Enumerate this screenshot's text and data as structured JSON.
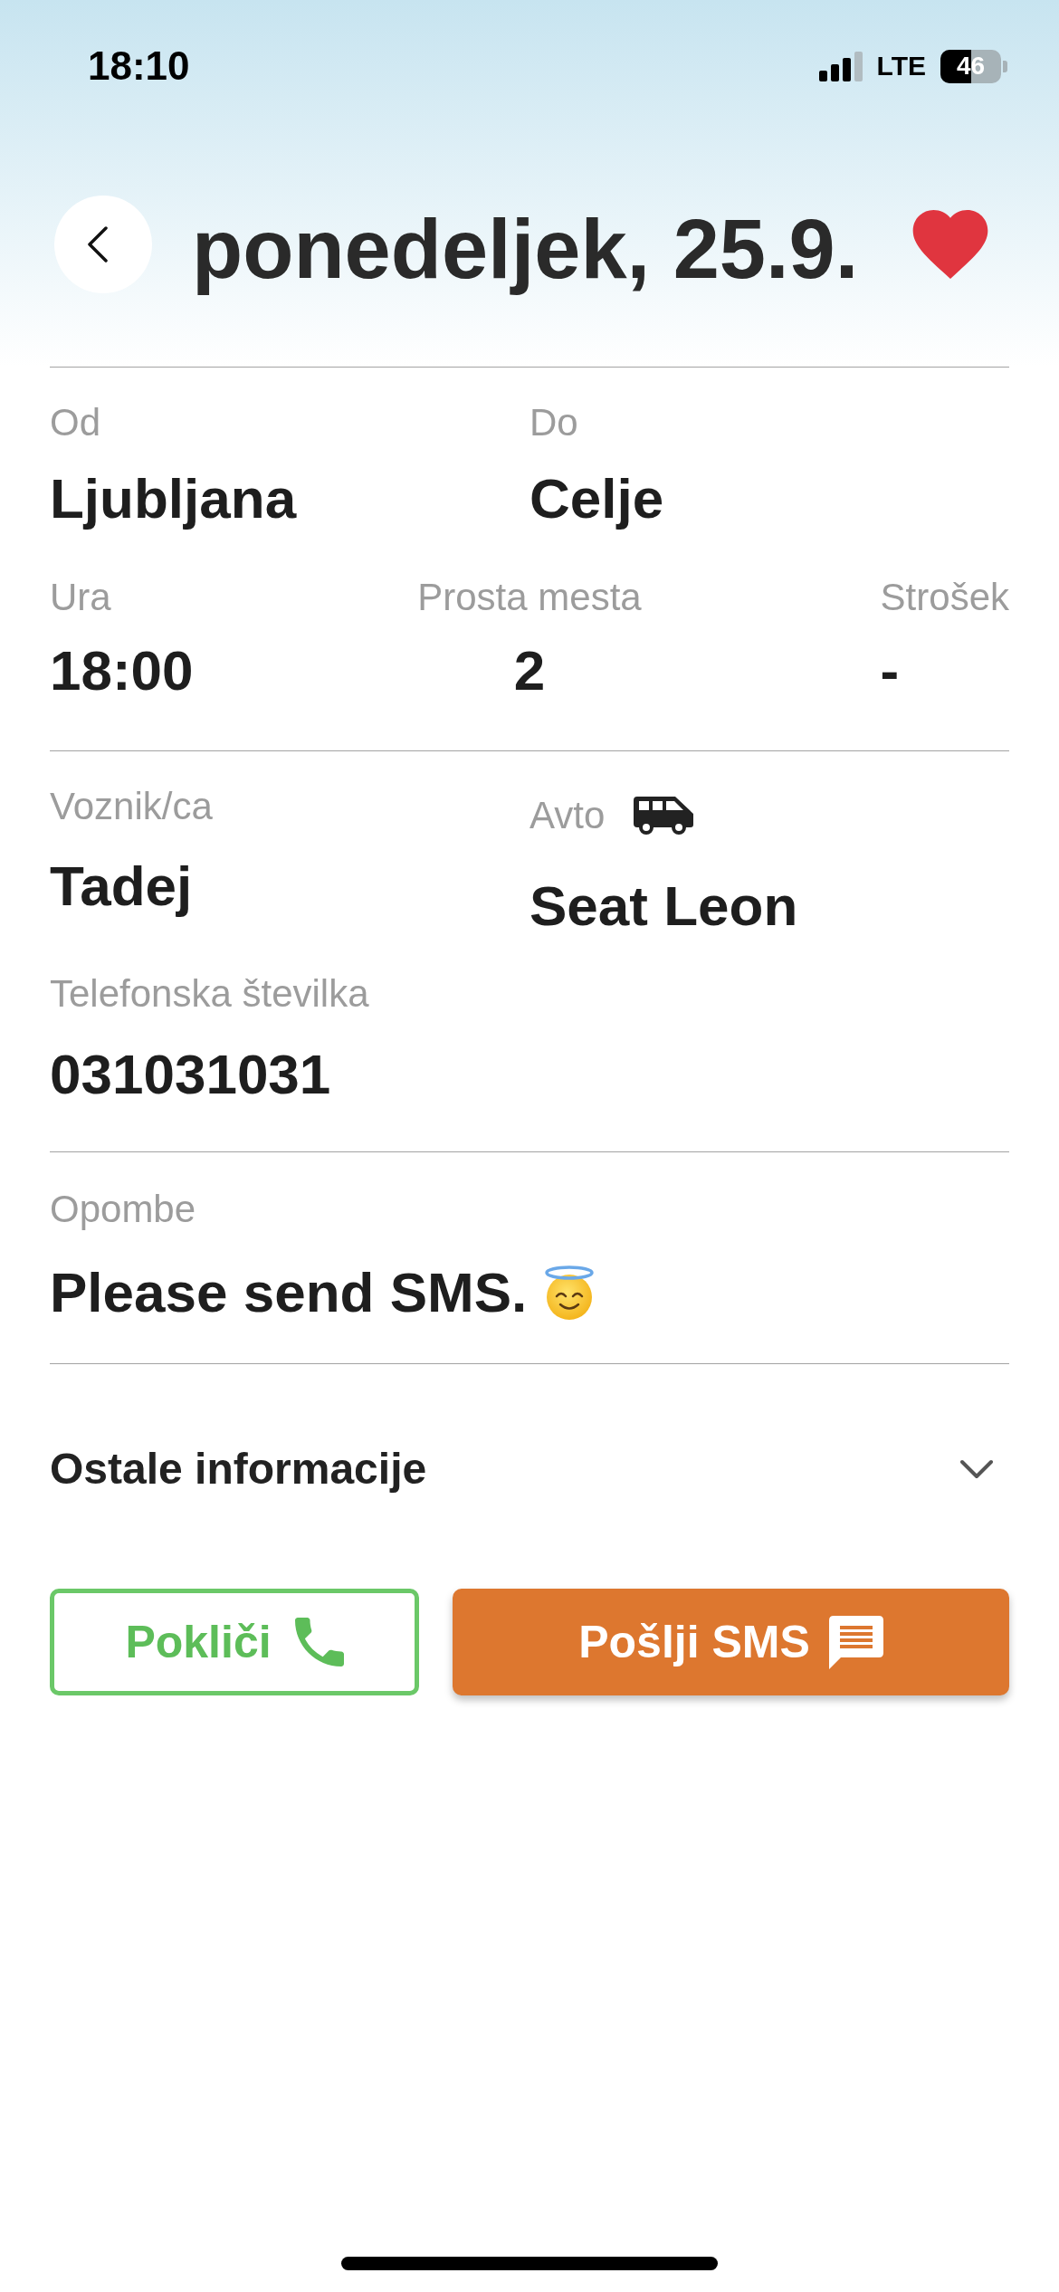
{
  "status_bar": {
    "time": "18:10",
    "network": "LTE",
    "battery": "46"
  },
  "header": {
    "title": "ponedeljek, 25.9.",
    "favorite": true
  },
  "route": [
    {
      "label": "Od",
      "value": "Ljubljana"
    },
    {
      "label": "Do",
      "value": "Celje"
    }
  ],
  "trip": [
    {
      "label": "Ura",
      "value": "18:00"
    },
    {
      "label": "Prosta mesta",
      "value": "2"
    },
    {
      "label": "Strošek",
      "value": "-"
    }
  ],
  "driver": {
    "label": "Voznik/ca",
    "value": "Tadej"
  },
  "car": {
    "label": "Avto",
    "value": "Seat Leon"
  },
  "phone": {
    "label": "Telefonska številka",
    "value": "031031031"
  },
  "notes": {
    "label": "Opombe",
    "value": "Please send SMS."
  },
  "more_info": {
    "label": "Ostale informacije",
    "expanded": false
  },
  "actions": [
    {
      "kind": "call",
      "label": "Pokliči"
    },
    {
      "kind": "sms",
      "label": "Pošlji SMS"
    }
  ]
}
